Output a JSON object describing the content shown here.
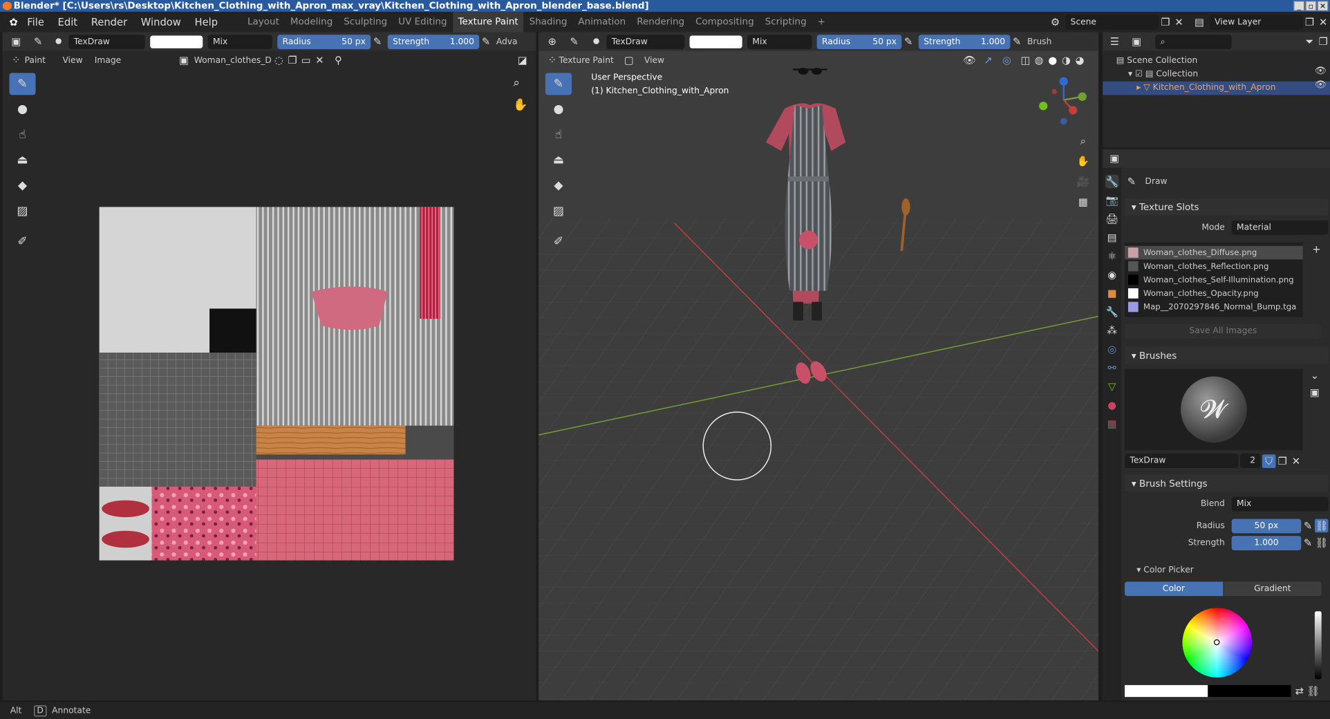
{
  "window": {
    "title": "Blender* [C:\\Users\\rs\\Desktop\\Kitchen_Clothing_with_Apron_max_vray\\Kitchen_Clothing_with_Apron_blender_base.blend]",
    "buttons": [
      "_",
      "▫",
      "✕"
    ]
  },
  "menu": {
    "items": [
      "File",
      "Edit",
      "Render",
      "Window",
      "Help"
    ],
    "workspaces": [
      "Layout",
      "Modeling",
      "Sculpting",
      "UV Editing",
      "Texture Paint",
      "Shading",
      "Animation",
      "Rendering",
      "Compositing",
      "Scripting"
    ],
    "active_workspace": "Texture Paint",
    "add_tab": "+",
    "scene": "Scene",
    "view_layer": "View Layer"
  },
  "image_editor": {
    "brush_name": "TexDraw",
    "blend": "Mix",
    "radius_label": "Radius",
    "radius_value": "50 px",
    "strength_label": "Strength",
    "strength_value": "1.000",
    "adv": "Adva",
    "mode": "Paint",
    "view": "View",
    "image_menu": "Image",
    "image_name": "Woman_clothes_Diff..."
  },
  "viewport": {
    "brush_name": "TexDraw",
    "blend": "Mix",
    "radius_label": "Radius",
    "radius_value": "50 px",
    "strength_label": "Strength",
    "strength_value": "1.000",
    "brush_menu": "Brush",
    "mode": "Texture Paint",
    "view": "View",
    "perspective": "User Perspective",
    "object_label": "(1) Kitchen_Clothing_with_Apron"
  },
  "outliner": {
    "scene_collection": "Scene Collection",
    "collection": "Collection",
    "object": "Kitchen_Clothing_with_Apron"
  },
  "properties": {
    "tool_name": "Draw",
    "texture_slots": "Texture Slots",
    "mode_label": "Mode",
    "mode_value": "Material",
    "slots": [
      {
        "name": "Woman_clothes_Diffuse.png",
        "color": "#c8a0a8"
      },
      {
        "name": "Woman_clothes_Reflection.png",
        "color": "#555555"
      },
      {
        "name": "Woman_clothes_Self-Illumination.png",
        "color": "#000000"
      },
      {
        "name": "Woman_clothes_Opacity.png",
        "color": "#ffffff"
      },
      {
        "name": "Map__2070297846_Normal_Bump.tga",
        "color": "#9a9ae0"
      }
    ],
    "save_all": "Save All Images",
    "brushes": "Brushes",
    "brush_name": "TexDraw",
    "brush_users": "2",
    "brush_settings": "Brush Settings",
    "blend_label": "Blend",
    "blend_value": "Mix",
    "radius_label": "Radius",
    "radius_value": "50 px",
    "strength_label": "Strength",
    "strength_value": "1.000",
    "color_picker": "Color Picker",
    "color_tab": "Color",
    "gradient_tab": "Gradient"
  },
  "status": {
    "key": "Alt",
    "key2": "D",
    "action": "Annotate"
  },
  "colors": {
    "accent": "#4772b3",
    "active_highlight": "#334d80",
    "x_axis": "#c63d3d",
    "y_axis": "#72a034"
  }
}
